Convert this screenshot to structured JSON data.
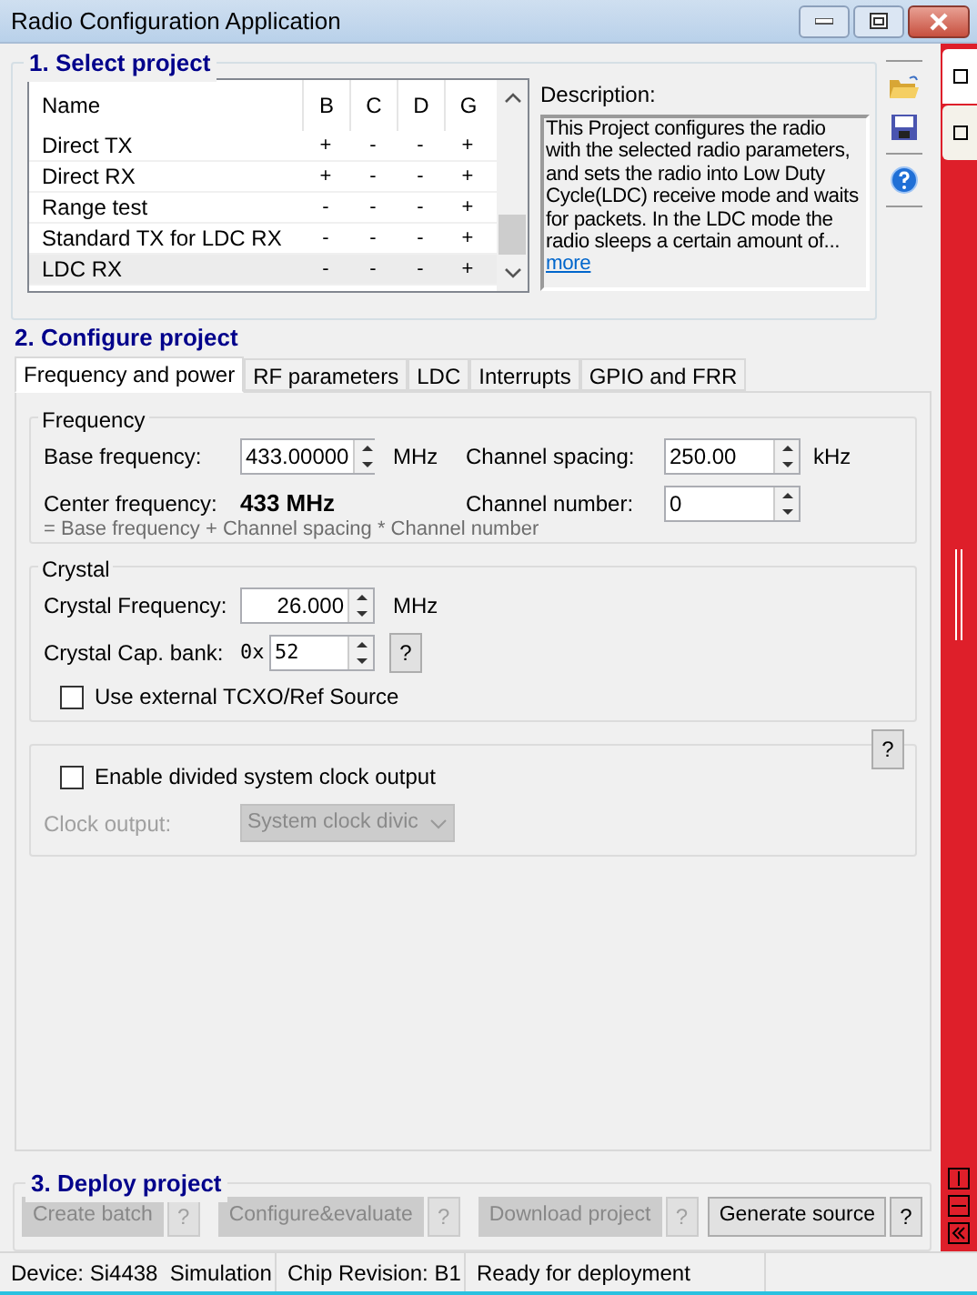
{
  "window": {
    "title": "Radio Configuration Application"
  },
  "select_project": {
    "title": "1. Select project",
    "table": {
      "columns": [
        "Name",
        "B",
        "C",
        "D",
        "G"
      ],
      "rows": [
        {
          "cells": [
            "Direct TX",
            "+",
            "-",
            "-",
            "+"
          ],
          "selected": false
        },
        {
          "cells": [
            "Direct RX",
            "+",
            "-",
            "-",
            "+"
          ],
          "selected": false
        },
        {
          "cells": [
            "Range test",
            "-",
            "-",
            "-",
            "+"
          ],
          "selected": false
        },
        {
          "cells": [
            "Standard TX for LDC RX",
            "-",
            "-",
            "-",
            "+"
          ],
          "selected": false
        },
        {
          "cells": [
            "LDC RX",
            "-",
            "-",
            "-",
            "+"
          ],
          "selected": true
        }
      ]
    },
    "description": {
      "label": "Description:",
      "text": "This Project configures the radio with the selected radio parameters, and sets the radio into Low Duty Cycle(LDC) receive mode and waits for packets. In the LDC mode the radio sleeps a certain amount of...",
      "link": "more"
    }
  },
  "configure_project": {
    "title": "2. Configure project",
    "tabs": [
      {
        "label": "Frequency and power",
        "selected": true
      },
      {
        "label": "RF parameters",
        "selected": false
      },
      {
        "label": "LDC",
        "selected": false
      },
      {
        "label": "Interrupts",
        "selected": false
      },
      {
        "label": "GPIO and FRR",
        "selected": false
      }
    ],
    "frequency": {
      "title": "Frequency",
      "base_label": "Base frequency:",
      "base_value": "433.00000",
      "base_unit": "MHz",
      "spacing_label": "Channel spacing:",
      "spacing_value": "250.00",
      "spacing_unit": "kHz",
      "center_label": "Center frequency:",
      "center_value": "433 MHz",
      "channel_label": "Channel number:",
      "channel_value": "0",
      "formula": "= Base frequency + Channel spacing * Channel number"
    },
    "crystal": {
      "title": "Crystal",
      "freq_label": "Crystal Frequency:",
      "freq_value": "26.000",
      "freq_unit": "MHz",
      "cap_label": "Crystal Cap. bank:",
      "cap_prefix": "0x",
      "cap_value": "52",
      "cap_help": "?",
      "tcxo": {
        "label": "Use external TCXO/Ref Source",
        "checked": false
      }
    },
    "clock": {
      "help": "?",
      "enable": {
        "label": "Enable divided system clock output",
        "checked": false
      },
      "output_label": "Clock output:",
      "output_value": "System clock divic",
      "disabled": true
    }
  },
  "deploy_project": {
    "title": "3. Deploy project",
    "buttons": [
      {
        "label": "Create batch",
        "help": "?",
        "disabled": true
      },
      {
        "label": "Configure&evaluate",
        "help": "?",
        "disabled": true
      },
      {
        "label": "Download project",
        "help": "?",
        "disabled": true
      },
      {
        "label": "Generate source",
        "help": "?",
        "disabled": false
      }
    ]
  },
  "status_bar": [
    "Device: Si4438  Simulation",
    "Chip Revision: B1",
    "Ready for deployment"
  ]
}
